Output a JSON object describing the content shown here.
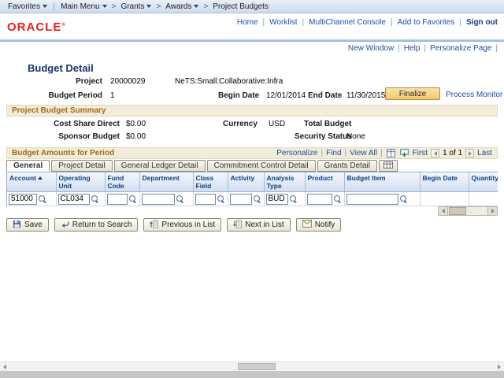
{
  "chrome": {
    "pipe": "|",
    "gt": ">",
    "reg": "®"
  },
  "breadcrumb": {
    "favorites": "Favorites",
    "path": [
      "Main Menu",
      "Grants",
      "Awards",
      "Project Budgets"
    ]
  },
  "header": {
    "logo": "ORACLE",
    "links": {
      "home": "Home",
      "worklist": "Worklist",
      "multichannel": "MultiChannel Console",
      "add_to_favorites": "Add to Favorites",
      "sign_out": "Sign out"
    }
  },
  "page_links": {
    "new_window": "New Window",
    "help": "Help",
    "personalize_page": "Personalize Page"
  },
  "page": {
    "title": "Budget Detail"
  },
  "detail": {
    "project_label": "Project",
    "project_id": "20000029",
    "project_name": "NeTS:Small:Collaborative:Infra",
    "budget_period_label": "Budget Period",
    "budget_period": "1",
    "begin_date_label": "Begin Date",
    "begin_date": "12/01/2014",
    "end_date_label": "End Date",
    "end_date": "11/30/2015",
    "finalize_button": "Finalize",
    "process_monitor_link": "Process Monitor"
  },
  "summary": {
    "title": "Project Budget Summary",
    "cost_share_direct_label": "Cost Share Direct",
    "cost_share_direct": "$0.00",
    "sponsor_budget_label": "Sponsor Budget",
    "sponsor_budget": "$0.00",
    "currency_label": "Currency",
    "currency": "USD",
    "total_budget_label": "Total Budget",
    "security_status_label": "Security Status",
    "security_status": "None"
  },
  "grid": {
    "title": "Budget Amounts for Period",
    "toolbar": {
      "personalize": "Personalize",
      "find": "Find",
      "view_all": "View All",
      "first": "First",
      "position": "1 of 1",
      "last": "Last"
    },
    "tabs": [
      "General",
      "Project Detail",
      "General Ledger Detail",
      "Commitment Control Detail",
      "Grants Detail"
    ],
    "columns": [
      "Account",
      "Operating Unit",
      "Fund Code",
      "Department",
      "Class Field",
      "Activity",
      "Analysis Type",
      "Product",
      "Budget Item",
      "Begin Date",
      "Quantity"
    ],
    "row": {
      "account": "51000",
      "operating_unit": "CL034",
      "fund_code": "",
      "department": "",
      "class_field": "",
      "activity": "",
      "analysis_type": "BUD",
      "product": "",
      "budget_item": ""
    }
  },
  "toolbar_buttons": {
    "save": "Save",
    "return_to_search": "Return to Search",
    "previous_in_list": "Previous in List",
    "next_in_list": "Next in List",
    "notify": "Notify"
  }
}
